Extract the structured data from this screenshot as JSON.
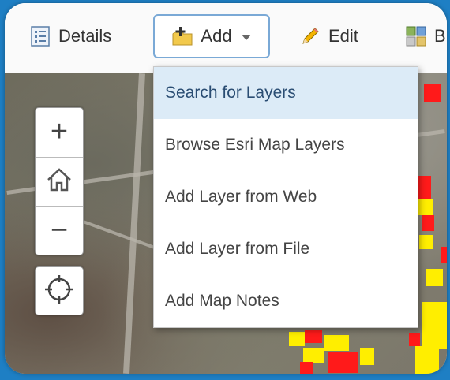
{
  "toolbar": {
    "details_label": "Details",
    "add_label": "Add",
    "edit_label": "Edit",
    "basemap_label": "B"
  },
  "add_menu": {
    "items": [
      {
        "label": "Search for Layers",
        "highlighted": true
      },
      {
        "label": "Browse Esri Map Layers"
      },
      {
        "label": "Add Layer from Web"
      },
      {
        "label": "Add Layer from File"
      },
      {
        "label": "Add Map Notes"
      }
    ]
  },
  "map_controls": {
    "zoom_in": "+",
    "zoom_out": "−"
  },
  "colors": {
    "frame_bg": "#1e7fc4",
    "menu_highlight": "#dcebf7",
    "feature_red": "#ff1a1a",
    "feature_yellow": "#ffee00"
  }
}
